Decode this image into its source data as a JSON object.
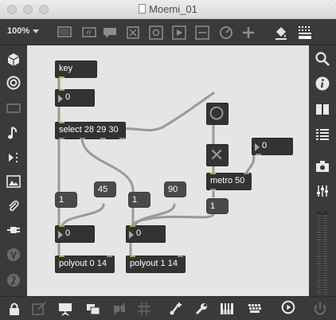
{
  "window": {
    "title": "Moemi_01"
  },
  "toolbar": {
    "zoom": "100%",
    "icons": [
      "presentation-icon",
      "note-icon",
      "comment-icon",
      "box-x-icon",
      "object-icon",
      "play-icon",
      "panel-icon",
      "dial-icon",
      "plus-icon",
      "paint-bucket-icon",
      "grid-icon"
    ]
  },
  "left_sidebar": [
    "package-icon",
    "target-icon",
    "panel-icon",
    "music-note-icon",
    "media-icon",
    "image-icon",
    "paperclip-icon",
    "plug-icon",
    "vst-icon",
    "beap-icon"
  ],
  "right_sidebar": [
    "search-icon",
    "info-icon",
    "book-icon",
    "list-icon",
    "camera-icon",
    "mixer-icon"
  ],
  "bottom_bar": [
    "lock-icon",
    "edit-icon",
    "presentation-icon",
    "windows-icon",
    "disabled-icon",
    "grid-icon",
    "add-icon",
    "wrench-icon",
    "keyboard-icon",
    "computer-keyboard-icon",
    "audio-on-icon",
    "power-icon"
  ],
  "patch": {
    "key": "key",
    "number1": "0",
    "select": "select 28 29 30",
    "msg_1a": "1",
    "msg_45": "45",
    "number2": "0",
    "polyout0": "polyout 0 14",
    "msg_1b": "1",
    "msg_90": "90",
    "number3": "0",
    "polyout1": "polyout 1 14",
    "number4": "0",
    "metro": "metro 50",
    "msg_1c": "1"
  }
}
